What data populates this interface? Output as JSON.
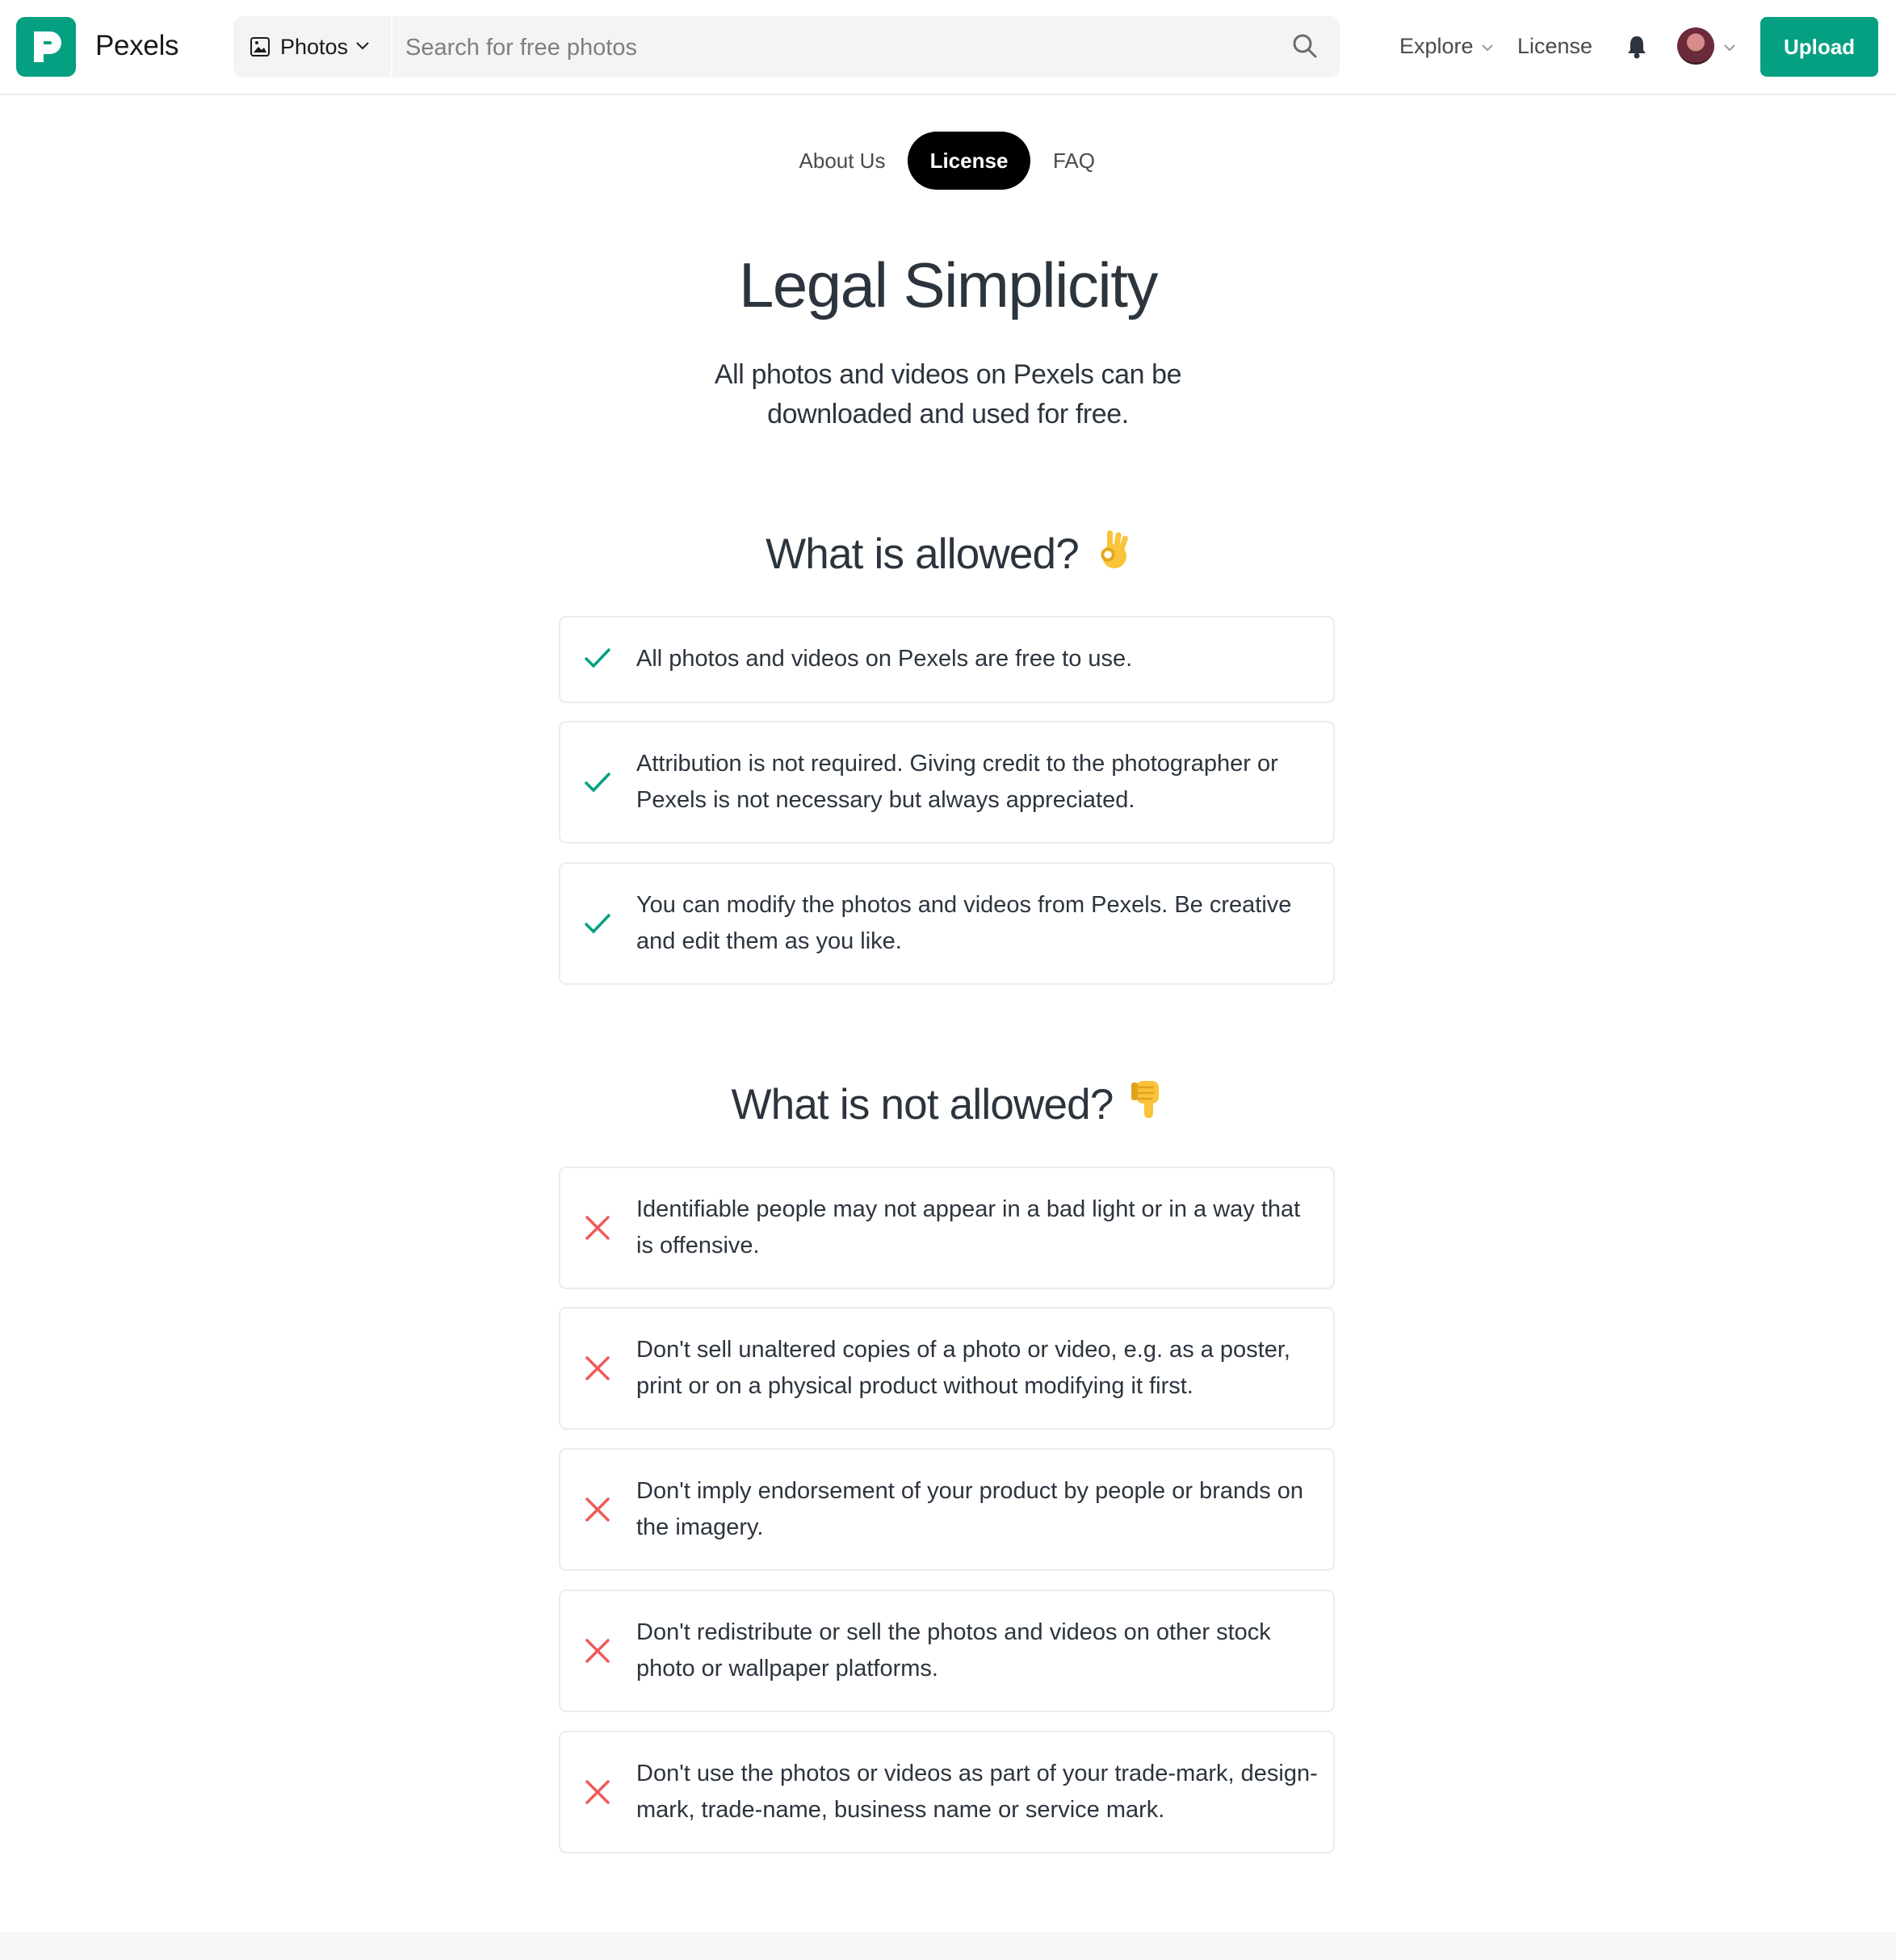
{
  "header": {
    "brand": "Pexels",
    "media_type": "Photos",
    "search_placeholder": "Search for free photos",
    "nav": {
      "explore": "Explore",
      "license": "License"
    },
    "upload_label": "Upload"
  },
  "tabs": [
    {
      "label": "About Us",
      "active": false
    },
    {
      "label": "License",
      "active": true
    },
    {
      "label": "FAQ",
      "active": false
    }
  ],
  "hero": {
    "title": "Legal Simplicity",
    "subtitle": "All photos and videos on Pexels can be downloaded and used for free."
  },
  "allowed": {
    "heading": "What is allowed?",
    "icon": "ok-hand-emoji",
    "items": [
      "All photos and videos on Pexels are free to use.",
      "Attribution is not required. Giving credit to the photographer or Pexels is not necessary but always appreciated.",
      "You can modify the photos and videos from Pexels. Be creative and edit them as you like."
    ]
  },
  "not_allowed": {
    "heading": "What is not allowed?",
    "icon": "thumbs-down-emoji",
    "items": [
      "Identifiable people may not appear in a bad light or in a way that is offensive.",
      "Don't sell unaltered copies of a photo or video, e.g. as a poster, print or on a physical product without modifying it first.",
      "Don't imply endorsement of your product by people or brands on the imagery.",
      "Don't redistribute or sell the photos and videos on other stock photo or wallpaper platforms.",
      "Don't use the photos or videos as part of your trade-mark, design-mark, trade-name, business name or service mark."
    ]
  },
  "colors": {
    "brand": "#05a081",
    "check": "#05a081",
    "cross": "#f05a5a",
    "text": "#2c343e"
  }
}
